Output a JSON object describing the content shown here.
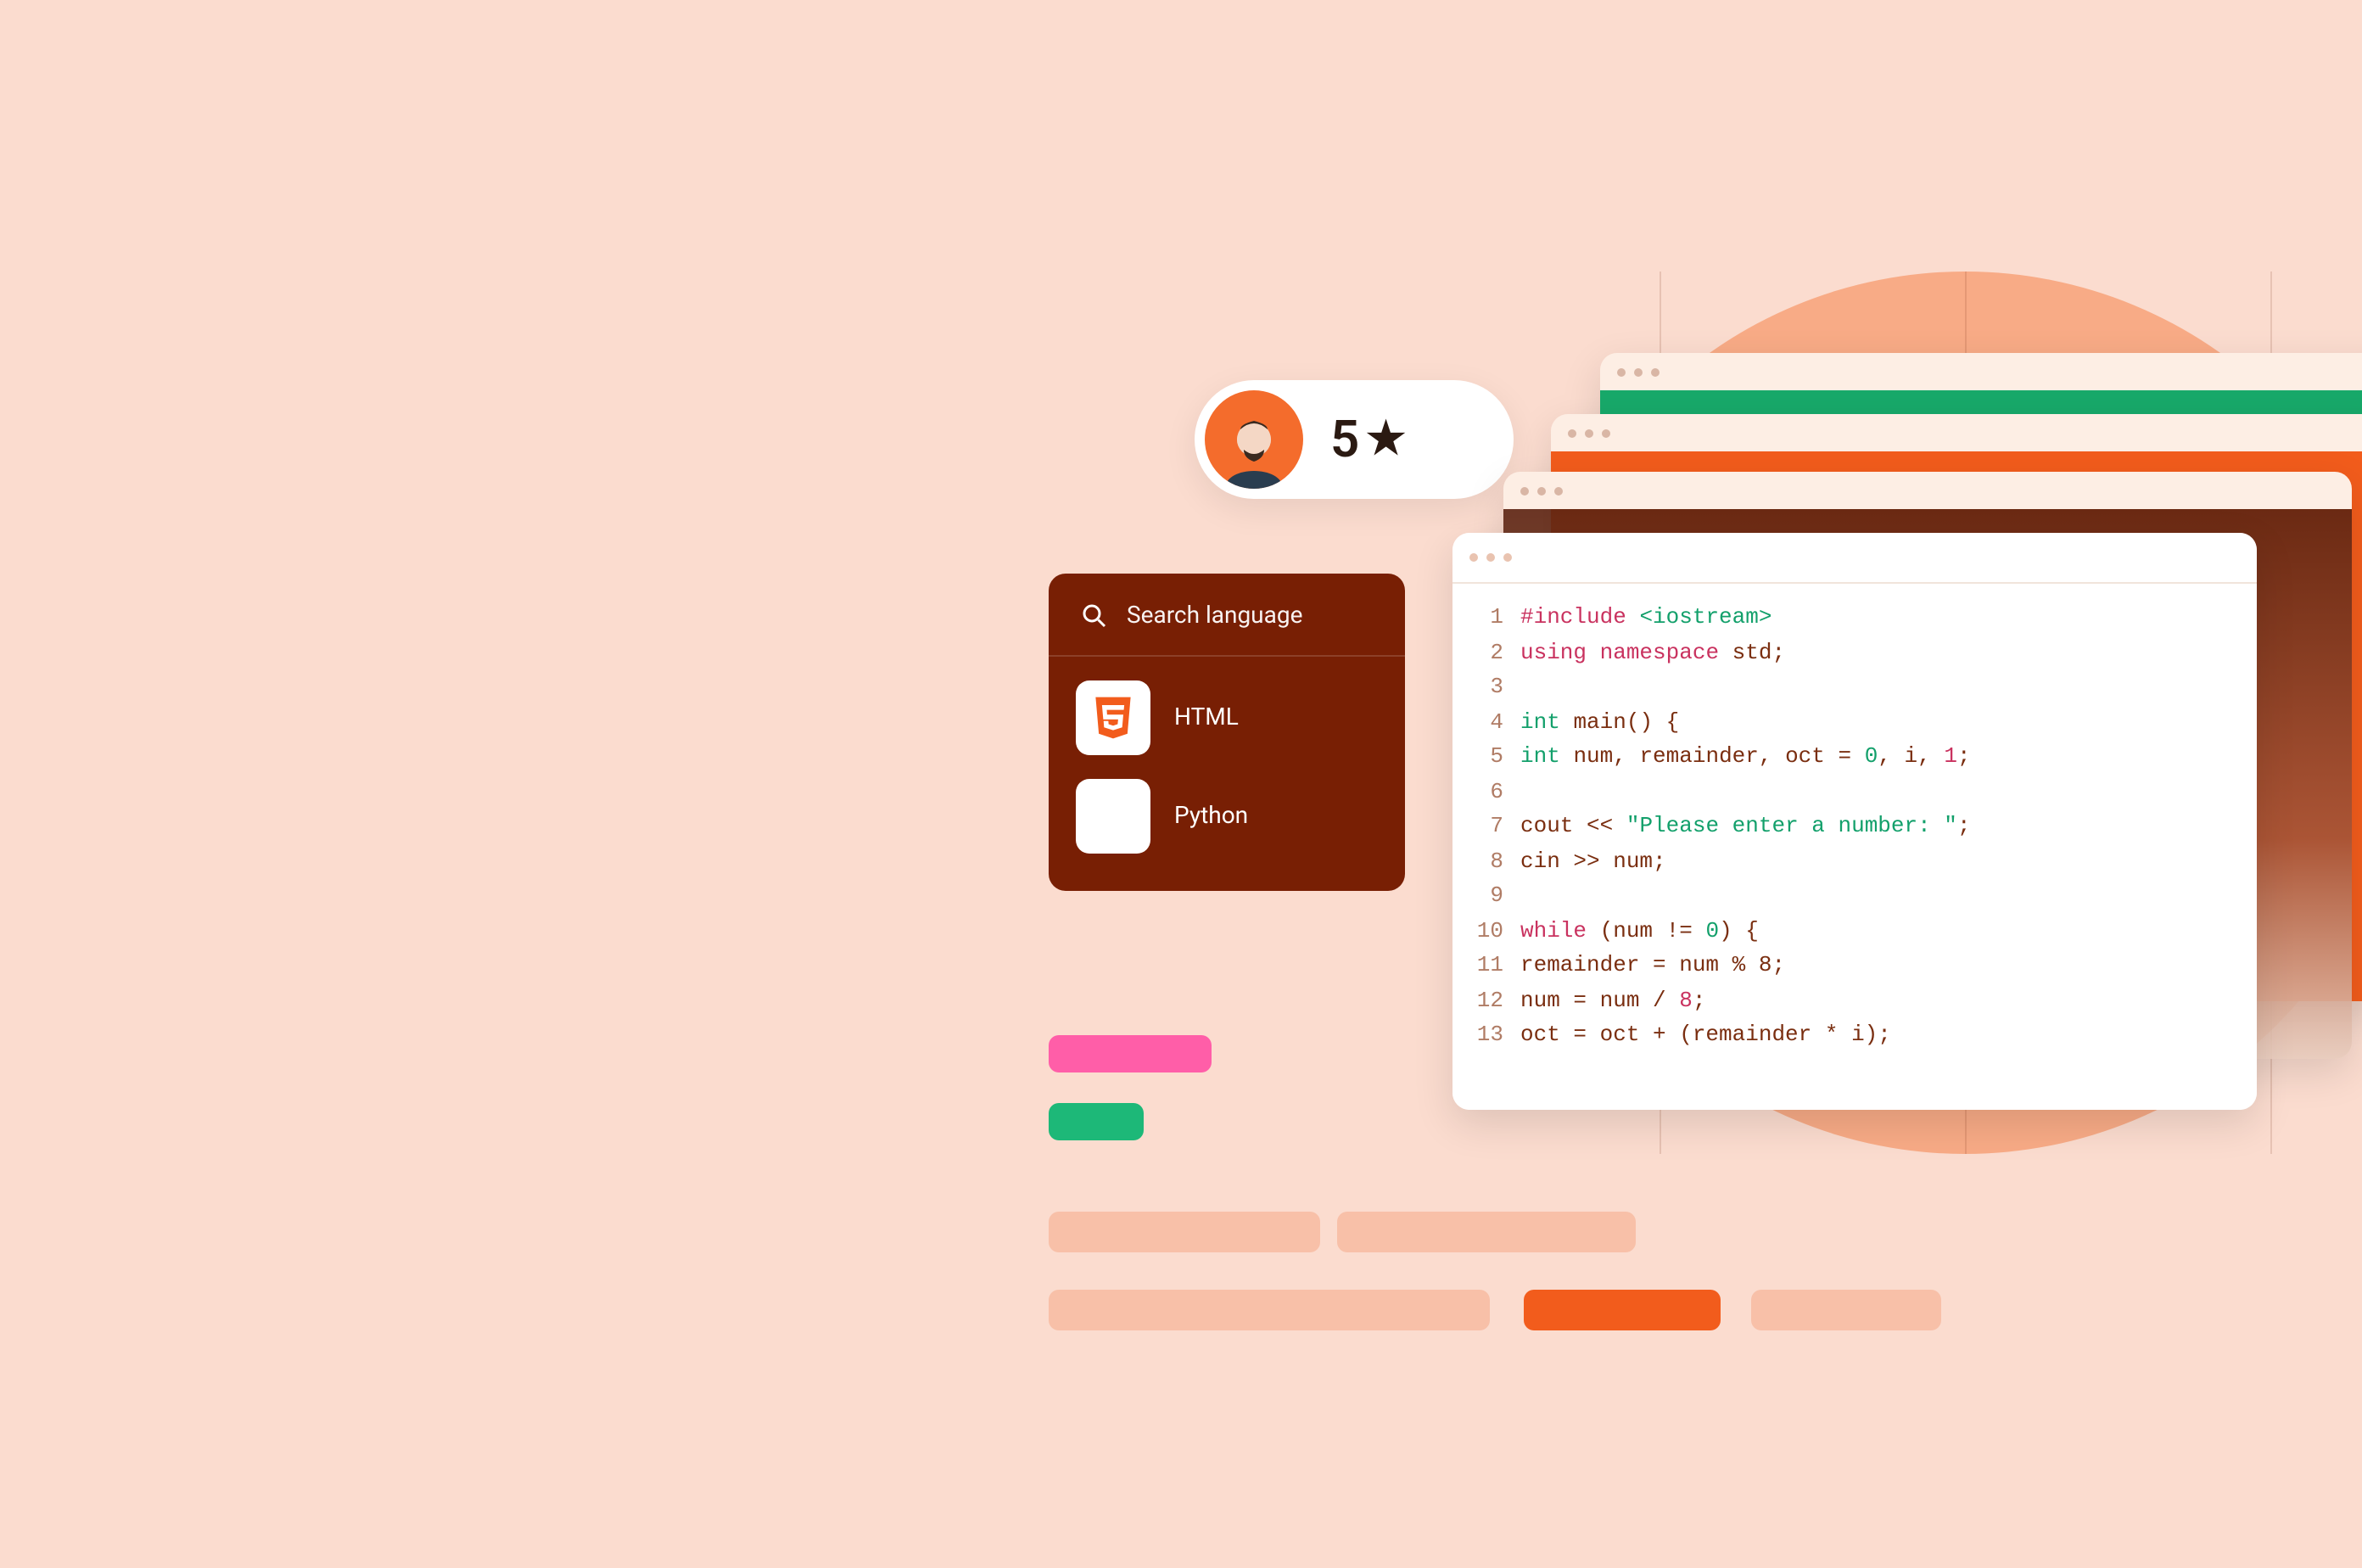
{
  "rating": {
    "score": "5",
    "star_glyph": "★"
  },
  "sidebar": {
    "search_placeholder": "Search language",
    "items": [
      {
        "label": "HTML",
        "icon": "html5-icon"
      },
      {
        "label": "Python",
        "icon": "blank-icon"
      }
    ]
  },
  "code": {
    "lines": [
      [
        {
          "t": "pre",
          "v": "#include "
        },
        {
          "t": "inc",
          "v": "<iostream>"
        }
      ],
      [
        {
          "t": "key",
          "v": "using "
        },
        {
          "t": "namek",
          "v": "namespace "
        },
        {
          "t": "plain",
          "v": "std;"
        }
      ],
      [],
      [
        {
          "t": "type",
          "v": "int "
        },
        {
          "t": "plain",
          "v": "main() {"
        }
      ],
      [
        {
          "t": "plain",
          "v": "  "
        },
        {
          "t": "type",
          "v": "int "
        },
        {
          "t": "plain",
          "v": "num, remainder, oct = "
        },
        {
          "t": "num",
          "v": "0"
        },
        {
          "t": "plain",
          "v": ", i, "
        },
        {
          "t": "num2",
          "v": "1"
        },
        {
          "t": "plain",
          "v": ";"
        }
      ],
      [],
      [
        {
          "t": "plain",
          "v": "  cout << "
        },
        {
          "t": "str",
          "v": "\"Please enter a number: \""
        },
        {
          "t": "plain",
          "v": ";"
        }
      ],
      [
        {
          "t": "plain",
          "v": "  cin >> num;"
        }
      ],
      [],
      [
        {
          "t": "plain",
          "v": "  "
        },
        {
          "t": "key",
          "v": "while "
        },
        {
          "t": "plain",
          "v": "(num != "
        },
        {
          "t": "num",
          "v": "0"
        },
        {
          "t": "plain",
          "v": ") {"
        }
      ],
      [
        {
          "t": "plain",
          "v": "    remainder = num % 8;"
        }
      ],
      [
        {
          "t": "plain",
          "v": "    num = num / "
        },
        {
          "t": "num2",
          "v": "8"
        },
        {
          "t": "plain",
          "v": ";"
        }
      ],
      [
        {
          "t": "plain",
          "v": "    oct = oct + (remainder * i);"
        }
      ]
    ]
  },
  "colors": {
    "brand_orange": "#f25c1c",
    "brand_brown": "#781f04",
    "accent_green": "#18a96a",
    "accent_pink": "#ff5ea8"
  }
}
